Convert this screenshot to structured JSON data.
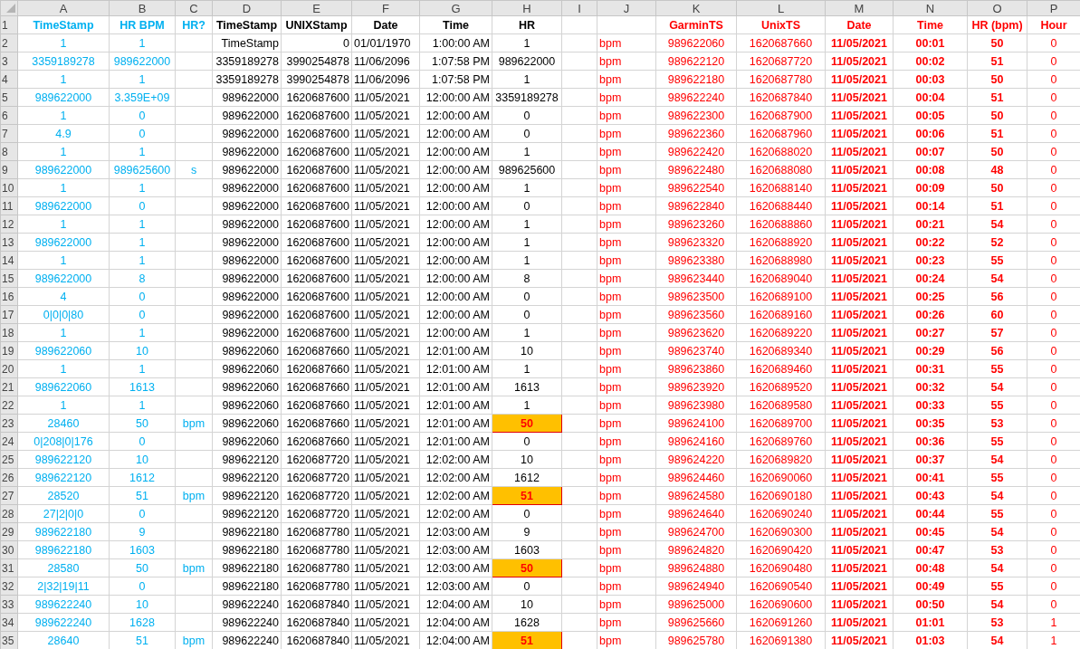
{
  "columns": [
    {
      "letter": "A",
      "kind": "raw"
    },
    {
      "letter": "B",
      "kind": "raw"
    },
    {
      "letter": "C",
      "kind": "raw"
    },
    {
      "letter": "D",
      "kind": "parsed"
    },
    {
      "letter": "E",
      "kind": "parsed"
    },
    {
      "letter": "F",
      "kind": "parsed"
    },
    {
      "letter": "G",
      "kind": "parsed"
    },
    {
      "letter": "H",
      "kind": "parsed"
    },
    {
      "letter": "I",
      "kind": "blank"
    },
    {
      "letter": "J",
      "kind": "result"
    },
    {
      "letter": "K",
      "kind": "result"
    },
    {
      "letter": "L",
      "kind": "result"
    },
    {
      "letter": "M",
      "kind": "result_bold"
    },
    {
      "letter": "N",
      "kind": "result_bold"
    },
    {
      "letter": "O",
      "kind": "result_bold"
    },
    {
      "letter": "P",
      "kind": "result"
    }
  ],
  "header_row": {
    "number": "1",
    "cells": [
      "TimeStamp",
      "HR BPM",
      "HR?",
      "TimeStamp",
      "UNIXStamp",
      "Date",
      "Time",
      "HR",
      null,
      null,
      "GarminTS",
      "UnixTS",
      "Date",
      "Time",
      "HR (bpm)",
      "Hour"
    ]
  },
  "rows": [
    {
      "number": "2",
      "highlighted": false,
      "cells": [
        "1",
        "1",
        null,
        "TimeStamp",
        "0",
        "01/01/1970",
        "1:00:00 AM",
        "1",
        null,
        "bpm",
        "989622060",
        "1620687660",
        "11/05/2021",
        "00:01",
        "50",
        "0"
      ]
    },
    {
      "number": "3",
      "highlighted": false,
      "cells": [
        "3359189278",
        "989622000",
        null,
        "3359189278",
        "3990254878",
        "11/06/2096",
        "1:07:58 PM",
        "989622000",
        null,
        "bpm",
        "989622120",
        "1620687720",
        "11/05/2021",
        "00:02",
        "51",
        "0"
      ]
    },
    {
      "number": "4",
      "highlighted": false,
      "cells": [
        "1",
        "1",
        null,
        "3359189278",
        "3990254878",
        "11/06/2096",
        "1:07:58 PM",
        "1",
        null,
        "bpm",
        "989622180",
        "1620687780",
        "11/05/2021",
        "00:03",
        "50",
        "0"
      ]
    },
    {
      "number": "5",
      "highlighted": false,
      "cells": [
        "989622000",
        "3.359E+09",
        null,
        "989622000",
        "1620687600",
        "11/05/2021",
        "12:00:00 AM",
        "3359189278",
        null,
        "bpm",
        "989622240",
        "1620687840",
        "11/05/2021",
        "00:04",
        "51",
        "0"
      ]
    },
    {
      "number": "6",
      "highlighted": false,
      "cells": [
        "1",
        "0",
        null,
        "989622000",
        "1620687600",
        "11/05/2021",
        "12:00:00 AM",
        "0",
        null,
        "bpm",
        "989622300",
        "1620687900",
        "11/05/2021",
        "00:05",
        "50",
        "0"
      ]
    },
    {
      "number": "7",
      "highlighted": false,
      "cells": [
        "4.9",
        "0",
        null,
        "989622000",
        "1620687600",
        "11/05/2021",
        "12:00:00 AM",
        "0",
        null,
        "bpm",
        "989622360",
        "1620687960",
        "11/05/2021",
        "00:06",
        "51",
        "0"
      ]
    },
    {
      "number": "8",
      "highlighted": false,
      "cells": [
        "1",
        "1",
        null,
        "989622000",
        "1620687600",
        "11/05/2021",
        "12:00:00 AM",
        "1",
        null,
        "bpm",
        "989622420",
        "1620688020",
        "11/05/2021",
        "00:07",
        "50",
        "0"
      ]
    },
    {
      "number": "9",
      "highlighted": false,
      "cells": [
        "989622000",
        "989625600",
        "s",
        "989622000",
        "1620687600",
        "11/05/2021",
        "12:00:00 AM",
        "989625600",
        null,
        "bpm",
        "989622480",
        "1620688080",
        "11/05/2021",
        "00:08",
        "48",
        "0"
      ]
    },
    {
      "number": "10",
      "highlighted": false,
      "cells": [
        "1",
        "1",
        null,
        "989622000",
        "1620687600",
        "11/05/2021",
        "12:00:00 AM",
        "1",
        null,
        "bpm",
        "989622540",
        "1620688140",
        "11/05/2021",
        "00:09",
        "50",
        "0"
      ]
    },
    {
      "number": "11",
      "highlighted": false,
      "cells": [
        "989622000",
        "0",
        null,
        "989622000",
        "1620687600",
        "11/05/2021",
        "12:00:00 AM",
        "0",
        null,
        "bpm",
        "989622840",
        "1620688440",
        "11/05/2021",
        "00:14",
        "51",
        "0"
      ]
    },
    {
      "number": "12",
      "highlighted": false,
      "cells": [
        "1",
        "1",
        null,
        "989622000",
        "1620687600",
        "11/05/2021",
        "12:00:00 AM",
        "1",
        null,
        "bpm",
        "989623260",
        "1620688860",
        "11/05/2021",
        "00:21",
        "54",
        "0"
      ]
    },
    {
      "number": "13",
      "highlighted": false,
      "cells": [
        "989622000",
        "1",
        null,
        "989622000",
        "1620687600",
        "11/05/2021",
        "12:00:00 AM",
        "1",
        null,
        "bpm",
        "989623320",
        "1620688920",
        "11/05/2021",
        "00:22",
        "52",
        "0"
      ]
    },
    {
      "number": "14",
      "highlighted": false,
      "cells": [
        "1",
        "1",
        null,
        "989622000",
        "1620687600",
        "11/05/2021",
        "12:00:00 AM",
        "1",
        null,
        "bpm",
        "989623380",
        "1620688980",
        "11/05/2021",
        "00:23",
        "55",
        "0"
      ]
    },
    {
      "number": "15",
      "highlighted": false,
      "cells": [
        "989622000",
        "8",
        null,
        "989622000",
        "1620687600",
        "11/05/2021",
        "12:00:00 AM",
        "8",
        null,
        "bpm",
        "989623440",
        "1620689040",
        "11/05/2021",
        "00:24",
        "54",
        "0"
      ]
    },
    {
      "number": "16",
      "highlighted": false,
      "cells": [
        "4",
        "0",
        null,
        "989622000",
        "1620687600",
        "11/05/2021",
        "12:00:00 AM",
        "0",
        null,
        "bpm",
        "989623500",
        "1620689100",
        "11/05/2021",
        "00:25",
        "56",
        "0"
      ]
    },
    {
      "number": "17",
      "highlighted": false,
      "cells": [
        "0|0|0|80",
        "0",
        null,
        "989622000",
        "1620687600",
        "11/05/2021",
        "12:00:00 AM",
        "0",
        null,
        "bpm",
        "989623560",
        "1620689160",
        "11/05/2021",
        "00:26",
        "60",
        "0"
      ]
    },
    {
      "number": "18",
      "highlighted": false,
      "cells": [
        "1",
        "1",
        null,
        "989622000",
        "1620687600",
        "11/05/2021",
        "12:00:00 AM",
        "1",
        null,
        "bpm",
        "989623620",
        "1620689220",
        "11/05/2021",
        "00:27",
        "57",
        "0"
      ]
    },
    {
      "number": "19",
      "highlighted": false,
      "cells": [
        "989622060",
        "10",
        null,
        "989622060",
        "1620687660",
        "11/05/2021",
        "12:01:00 AM",
        "10",
        null,
        "bpm",
        "989623740",
        "1620689340",
        "11/05/2021",
        "00:29",
        "56",
        "0"
      ]
    },
    {
      "number": "20",
      "highlighted": false,
      "cells": [
        "1",
        "1",
        null,
        "989622060",
        "1620687660",
        "11/05/2021",
        "12:01:00 AM",
        "1",
        null,
        "bpm",
        "989623860",
        "1620689460",
        "11/05/2021",
        "00:31",
        "55",
        "0"
      ]
    },
    {
      "number": "21",
      "highlighted": false,
      "cells": [
        "989622060",
        "1613",
        null,
        "989622060",
        "1620687660",
        "11/05/2021",
        "12:01:00 AM",
        "1613",
        null,
        "bpm",
        "989623920",
        "1620689520",
        "11/05/2021",
        "00:32",
        "54",
        "0"
      ]
    },
    {
      "number": "22",
      "highlighted": false,
      "cells": [
        "1",
        "1",
        null,
        "989622060",
        "1620687660",
        "11/05/2021",
        "12:01:00 AM",
        "1",
        null,
        "bpm",
        "989623980",
        "1620689580",
        "11/05/2021",
        "00:33",
        "55",
        "0"
      ]
    },
    {
      "number": "23",
      "highlighted": true,
      "cells": [
        "28460",
        "50",
        "bpm",
        "989622060",
        "1620687660",
        "11/05/2021",
        "12:01:00 AM",
        "50",
        null,
        "bpm",
        "989624100",
        "1620689700",
        "11/05/2021",
        "00:35",
        "53",
        "0"
      ]
    },
    {
      "number": "24",
      "highlighted": false,
      "cells": [
        "0|208|0|176",
        "0",
        null,
        "989622060",
        "1620687660",
        "11/05/2021",
        "12:01:00 AM",
        "0",
        null,
        "bpm",
        "989624160",
        "1620689760",
        "11/05/2021",
        "00:36",
        "55",
        "0"
      ]
    },
    {
      "number": "25",
      "highlighted": false,
      "cells": [
        "989622120",
        "10",
        null,
        "989622120",
        "1620687720",
        "11/05/2021",
        "12:02:00 AM",
        "10",
        null,
        "bpm",
        "989624220",
        "1620689820",
        "11/05/2021",
        "00:37",
        "54",
        "0"
      ]
    },
    {
      "number": "26",
      "highlighted": false,
      "cells": [
        "989622120",
        "1612",
        null,
        "989622120",
        "1620687720",
        "11/05/2021",
        "12:02:00 AM",
        "1612",
        null,
        "bpm",
        "989624460",
        "1620690060",
        "11/05/2021",
        "00:41",
        "55",
        "0"
      ]
    },
    {
      "number": "27",
      "highlighted": true,
      "cells": [
        "28520",
        "51",
        "bpm",
        "989622120",
        "1620687720",
        "11/05/2021",
        "12:02:00 AM",
        "51",
        null,
        "bpm",
        "989624580",
        "1620690180",
        "11/05/2021",
        "00:43",
        "54",
        "0"
      ]
    },
    {
      "number": "28",
      "highlighted": false,
      "cells": [
        "27|2|0|0",
        "0",
        null,
        "989622120",
        "1620687720",
        "11/05/2021",
        "12:02:00 AM",
        "0",
        null,
        "bpm",
        "989624640",
        "1620690240",
        "11/05/2021",
        "00:44",
        "55",
        "0"
      ]
    },
    {
      "number": "29",
      "highlighted": false,
      "cells": [
        "989622180",
        "9",
        null,
        "989622180",
        "1620687780",
        "11/05/2021",
        "12:03:00 AM",
        "9",
        null,
        "bpm",
        "989624700",
        "1620690300",
        "11/05/2021",
        "00:45",
        "54",
        "0"
      ]
    },
    {
      "number": "30",
      "highlighted": false,
      "cells": [
        "989622180",
        "1603",
        null,
        "989622180",
        "1620687780",
        "11/05/2021",
        "12:03:00 AM",
        "1603",
        null,
        "bpm",
        "989624820",
        "1620690420",
        "11/05/2021",
        "00:47",
        "53",
        "0"
      ]
    },
    {
      "number": "31",
      "highlighted": true,
      "cells": [
        "28580",
        "50",
        "bpm",
        "989622180",
        "1620687780",
        "11/05/2021",
        "12:03:00 AM",
        "50",
        null,
        "bpm",
        "989624880",
        "1620690480",
        "11/05/2021",
        "00:48",
        "54",
        "0"
      ]
    },
    {
      "number": "32",
      "highlighted": false,
      "cells": [
        "2|32|19|11",
        "0",
        null,
        "989622180",
        "1620687780",
        "11/05/2021",
        "12:03:00 AM",
        "0",
        null,
        "bpm",
        "989624940",
        "1620690540",
        "11/05/2021",
        "00:49",
        "55",
        "0"
      ]
    },
    {
      "number": "33",
      "highlighted": false,
      "cells": [
        "989622240",
        "10",
        null,
        "989622240",
        "1620687840",
        "11/05/2021",
        "12:04:00 AM",
        "10",
        null,
        "bpm",
        "989625000",
        "1620690600",
        "11/05/2021",
        "00:50",
        "54",
        "0"
      ]
    },
    {
      "number": "34",
      "highlighted": false,
      "cells": [
        "989622240",
        "1628",
        null,
        "989622240",
        "1620687840",
        "11/05/2021",
        "12:04:00 AM",
        "1628",
        null,
        "bpm",
        "989625660",
        "1620691260",
        "11/05/2021",
        "01:01",
        "53",
        "1"
      ]
    },
    {
      "number": "35",
      "highlighted": true,
      "cells": [
        "28640",
        "51",
        "bpm",
        "989622240",
        "1620687840",
        "11/05/2021",
        "12:04:00 AM",
        "51",
        null,
        "bpm",
        "989625780",
        "1620691380",
        "11/05/2021",
        "01:03",
        "54",
        "1"
      ]
    }
  ]
}
